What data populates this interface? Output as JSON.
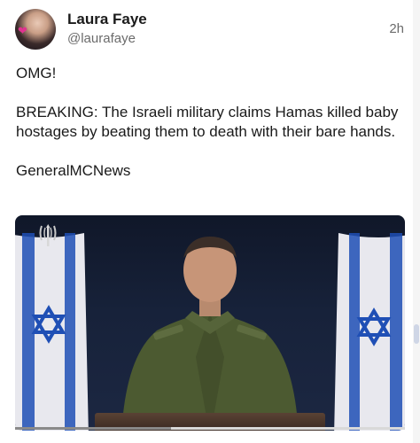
{
  "post": {
    "author": {
      "display_name": "Laura Faye",
      "handle": "@laurafaye",
      "avatar_icon": "profile-photo"
    },
    "timestamp": "2h",
    "body": [
      "OMG!",
      "BREAKING: The Israeli military claims Hamas killed baby hostages by beating them to death with their bare hands.",
      "GeneralMCNews"
    ],
    "media": {
      "type": "video",
      "progress": 0.4,
      "logo_icon": "idf-emblem-icon"
    }
  },
  "colors": {
    "text": "#1a1a1a",
    "secondary_text": "#6b6b6b",
    "flag_blue": "#1f4fb5"
  }
}
